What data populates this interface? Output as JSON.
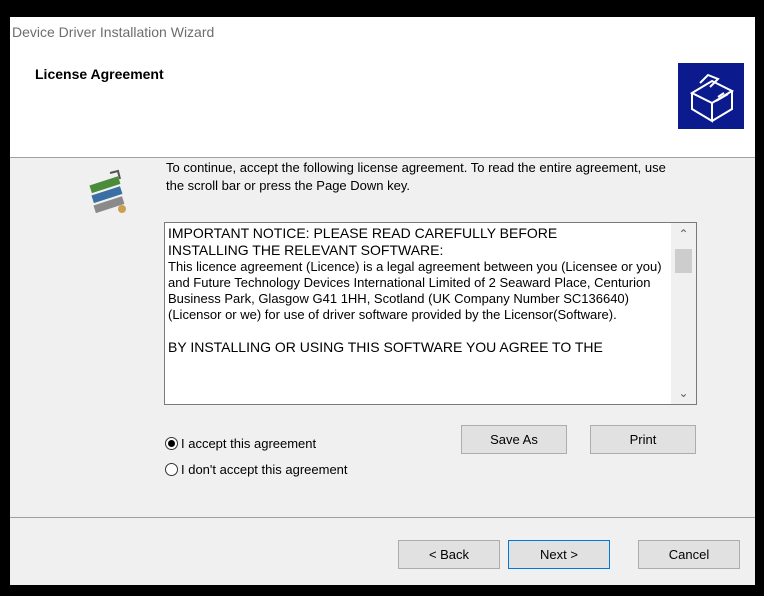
{
  "window": {
    "title": "Device Driver Installation Wizard"
  },
  "header": {
    "title": "License Agreement",
    "icon": "installer-box-icon"
  },
  "intro": {
    "icon": "scroll-book-icon",
    "text": "To continue, accept the following license agreement. To read the entire agreement, use the scroll bar or press the Page Down key."
  },
  "license": {
    "line1": "IMPORTANT NOTICE: PLEASE READ CAREFULLY BEFORE",
    "line2": "INSTALLING THE RELEVANT SOFTWARE:",
    "body": "This licence agreement (Licence) is a legal agreement between you (Licensee or you) and Future Technology Devices International Limited of 2 Seaward Place, Centurion Business Park, Glasgow G41 1HH, Scotland (UK Company Number SC136640) (Licensor or we) for use of driver software provided by the Licensor(Software).",
    "last": "BY INSTALLING OR USING THIS SOFTWARE YOU AGREE TO THE"
  },
  "options": {
    "accept_label": "I accept this agreement",
    "decline_label": "I don't accept this agreement",
    "selected": "accept"
  },
  "buttons": {
    "save_as": "Save As",
    "print": "Print",
    "back": "< Back",
    "next": "Next >",
    "cancel": "Cancel"
  }
}
